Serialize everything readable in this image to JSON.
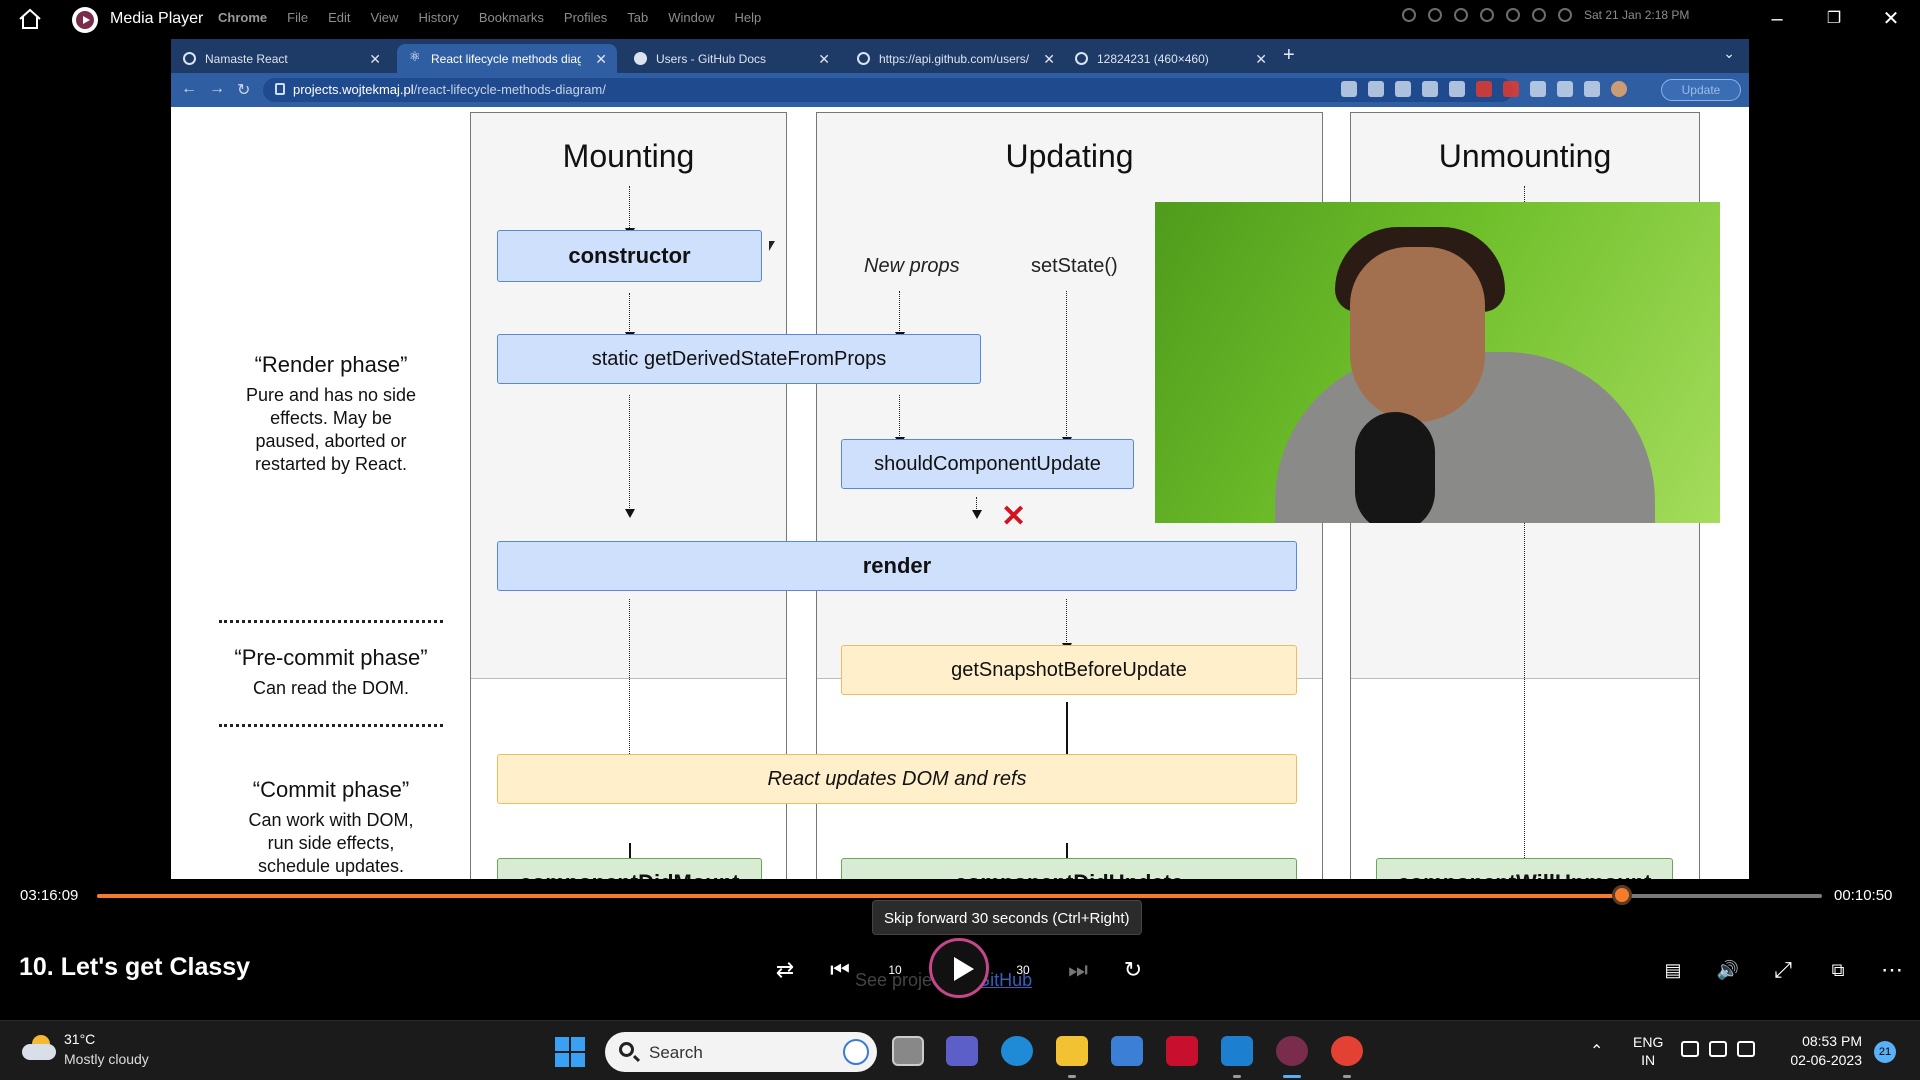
{
  "player": {
    "app_title": "Media Player",
    "media_title": "10. Let's get Classy",
    "elapsed": "03:16:09",
    "remaining": "00:10:50",
    "progress_fraction": 0.884,
    "tooltip": "Skip forward 30 seconds (Ctrl+Right)",
    "skip_back_label": "10",
    "skip_forward_label": "30",
    "accent_color": "#f47c2c"
  },
  "mac_menubar": {
    "items": [
      "Chrome",
      "File",
      "Edit",
      "View",
      "History",
      "Bookmarks",
      "Profiles",
      "Tab",
      "Window",
      "Help"
    ],
    "datetime": "Sat 21 Jan  2:18 PM"
  },
  "browser": {
    "tabs": [
      {
        "label": "Namaste React",
        "active": false
      },
      {
        "label": "React lifecycle methods diagra",
        "active": true
      },
      {
        "label": "Users - GitHub Docs",
        "active": false
      },
      {
        "label": "https://api.github.com/users/ak",
        "active": false
      },
      {
        "label": "12824231 (460×460)",
        "active": false
      }
    ],
    "url_host": "projects.wojtekmaj.pl",
    "url_path": "/react-lifecycle-methods-diagram/",
    "update_label": "Update"
  },
  "diagram": {
    "columns": [
      "Mounting",
      "Updating",
      "Unmounting"
    ],
    "phases": [
      {
        "title": "“Render phase”",
        "desc": [
          "Pure and has no side",
          "effects. May be",
          "paused, aborted or",
          "restarted by React."
        ]
      },
      {
        "title": "“Pre-commit phase”",
        "desc": [
          "Can read the DOM."
        ]
      },
      {
        "title": "“Commit phase”",
        "desc": [
          "Can work with DOM,",
          "run side effects,",
          "schedule updates."
        ]
      }
    ],
    "boxes": {
      "constructor": "constructor",
      "gdsfp": "static getDerivedStateFromProps",
      "scu": "shouldComponentUpdate",
      "render": "render",
      "gsbu": "getSnapshotBeforeUpdate",
      "dom_update": "React updates DOM and refs",
      "cdm": "componentDidMount",
      "cdu": "componentDidUpdate",
      "cwu": "componentWillUnmount"
    },
    "annotations": {
      "new_props": "New props",
      "set_state": "setState()"
    },
    "x_mark": "✕",
    "footer_prefix": "See project on ",
    "footer_link": "GitHub"
  },
  "taskbar": {
    "weather_temp": "31°C",
    "weather_desc": "Mostly cloudy",
    "search_label": "Search",
    "lang_line1": "ENG",
    "lang_line2": "IN",
    "time": "08:53 PM",
    "date": "02-06-2023",
    "notification_count": "21"
  }
}
